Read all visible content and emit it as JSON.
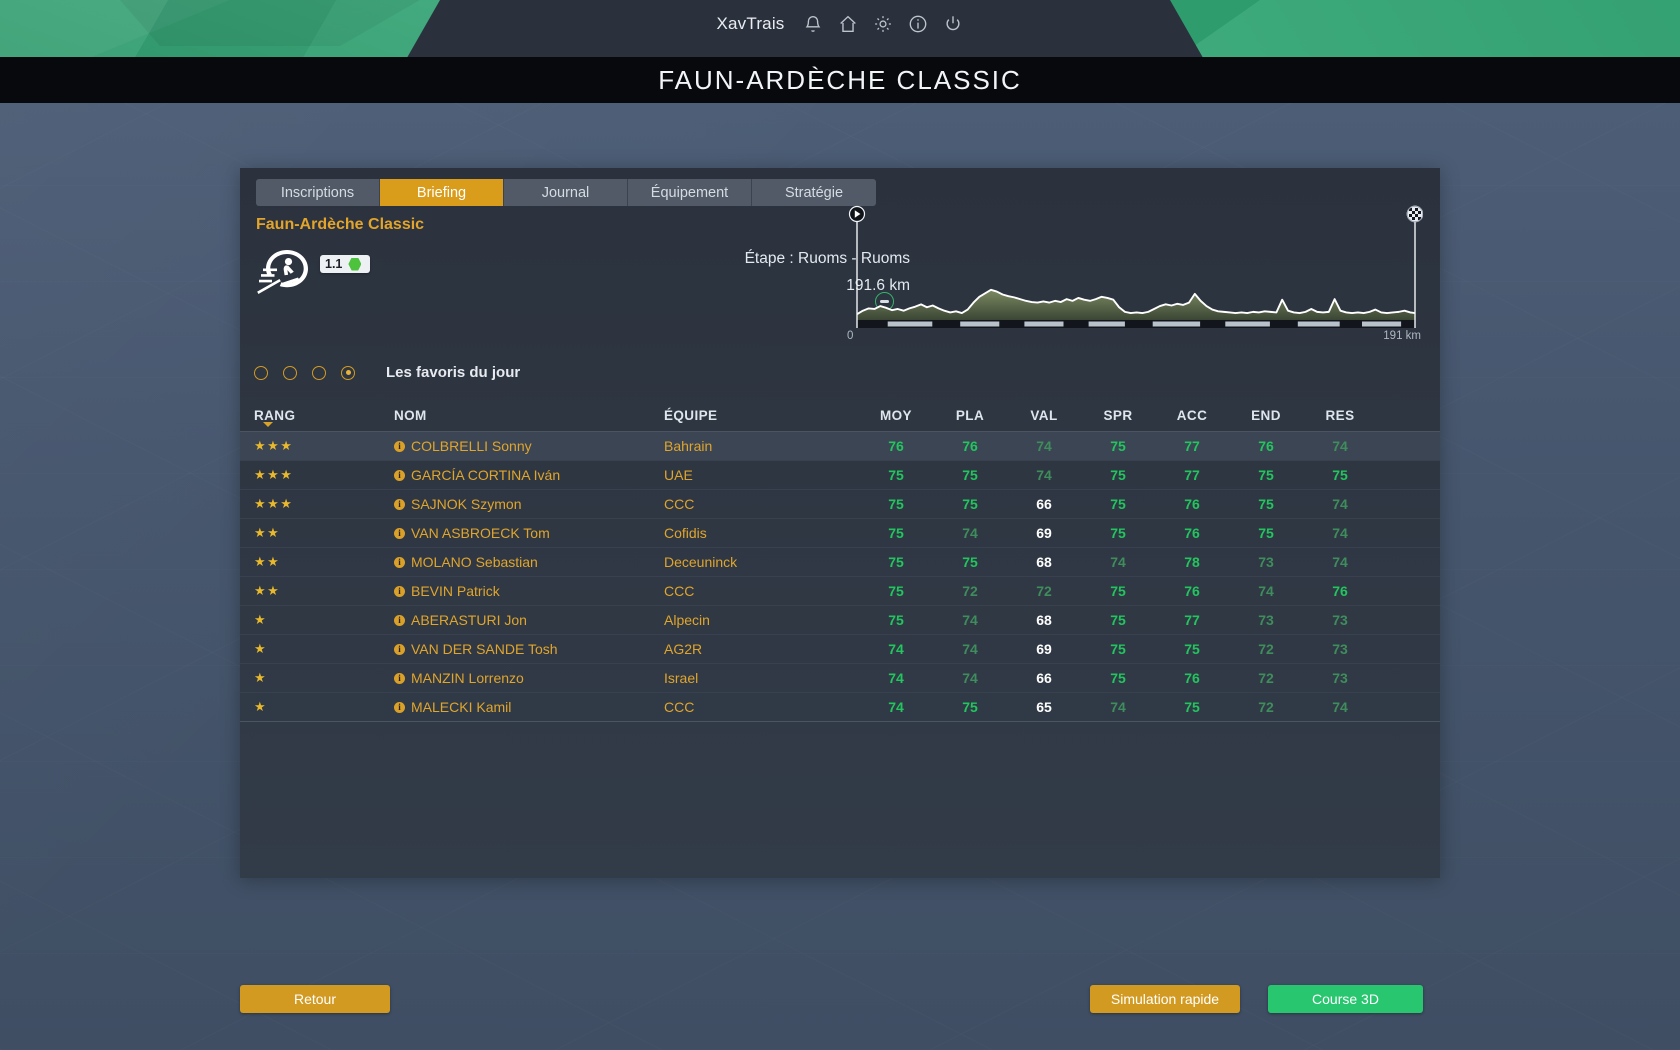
{
  "topbar": {
    "username": "XavTrais",
    "icons": [
      {
        "name": "bell-icon",
        "glyph": "bell"
      },
      {
        "name": "home-icon",
        "glyph": "home"
      },
      {
        "name": "gear-icon",
        "glyph": "gear"
      },
      {
        "name": "info-icon",
        "glyph": "info"
      },
      {
        "name": "power-icon",
        "glyph": "power"
      }
    ],
    "accent_green": "#2f9c6e",
    "center_dark": "#2b313c"
  },
  "title_band": {
    "title": "FAUN-ARDÈCHE CLASSIC"
  },
  "tabs": [
    {
      "label": "Inscriptions",
      "active": false
    },
    {
      "label": "Briefing",
      "active": true
    },
    {
      "label": "Journal",
      "active": false
    },
    {
      "label": "Équipement",
      "active": false
    },
    {
      "label": "Stratégie",
      "active": false
    }
  ],
  "race": {
    "name": "Faun-Ardèche Classic",
    "category_badge": "1.1",
    "badge_dot_color": "#4cc23d",
    "stage_label": "Étape : Ruoms - Ruoms",
    "distance": "191.6 km",
    "terrain_icon": "flat-stage-icon",
    "logo_icon": "cyclist-logo-icon"
  },
  "favorites_selector": {
    "options": 4,
    "selected_index": 3,
    "label": "Les favoris du jour"
  },
  "table": {
    "columns": [
      "RANG",
      "NOM",
      "ÉQUIPE",
      "MOY",
      "PLA",
      "VAL",
      "SPR",
      "ACC",
      "END",
      "RES"
    ],
    "sort_column": "RANG",
    "rows": [
      {
        "stars": 3,
        "name": "COLBRELLI Sonny",
        "team": "Bahrain",
        "moy": {
          "v": "76",
          "t": "hi"
        },
        "pla": {
          "v": "76",
          "t": "hi"
        },
        "val": {
          "v": "74",
          "t": "mid"
        },
        "spr": {
          "v": "75",
          "t": "hi"
        },
        "acc": {
          "v": "77",
          "t": "hi"
        },
        "end": {
          "v": "76",
          "t": "hi"
        },
        "res": {
          "v": "74",
          "t": "mid"
        },
        "selected": true
      },
      {
        "stars": 3,
        "name": "GARCÍA CORTINA Iván",
        "team": "UAE",
        "moy": {
          "v": "75",
          "t": "hi"
        },
        "pla": {
          "v": "75",
          "t": "hi"
        },
        "val": {
          "v": "74",
          "t": "mid"
        },
        "spr": {
          "v": "75",
          "t": "hi"
        },
        "acc": {
          "v": "77",
          "t": "hi"
        },
        "end": {
          "v": "75",
          "t": "hi"
        },
        "res": {
          "v": "75",
          "t": "hi"
        },
        "selected": false
      },
      {
        "stars": 3,
        "name": "SAJNOK Szymon",
        "team": "CCC",
        "moy": {
          "v": "75",
          "t": "hi"
        },
        "pla": {
          "v": "75",
          "t": "hi"
        },
        "val": {
          "v": "66",
          "t": "lo"
        },
        "spr": {
          "v": "75",
          "t": "hi"
        },
        "acc": {
          "v": "76",
          "t": "hi"
        },
        "end": {
          "v": "75",
          "t": "hi"
        },
        "res": {
          "v": "74",
          "t": "mid"
        },
        "selected": false
      },
      {
        "stars": 2,
        "name": "VAN ASBROECK Tom",
        "team": "Cofidis",
        "moy": {
          "v": "75",
          "t": "hi"
        },
        "pla": {
          "v": "74",
          "t": "mid"
        },
        "val": {
          "v": "69",
          "t": "lo"
        },
        "spr": {
          "v": "75",
          "t": "hi"
        },
        "acc": {
          "v": "76",
          "t": "hi"
        },
        "end": {
          "v": "75",
          "t": "hi"
        },
        "res": {
          "v": "74",
          "t": "mid"
        },
        "selected": false
      },
      {
        "stars": 2,
        "name": "MOLANO Sebastian",
        "team": "Deceuninck",
        "moy": {
          "v": "75",
          "t": "hi"
        },
        "pla": {
          "v": "75",
          "t": "hi"
        },
        "val": {
          "v": "68",
          "t": "lo"
        },
        "spr": {
          "v": "74",
          "t": "mid"
        },
        "acc": {
          "v": "78",
          "t": "hi"
        },
        "end": {
          "v": "73",
          "t": "mid"
        },
        "res": {
          "v": "74",
          "t": "mid"
        },
        "selected": false
      },
      {
        "stars": 2,
        "name": "BEVIN Patrick",
        "team": "CCC",
        "moy": {
          "v": "75",
          "t": "hi"
        },
        "pla": {
          "v": "72",
          "t": "mid"
        },
        "val": {
          "v": "72",
          "t": "mid"
        },
        "spr": {
          "v": "75",
          "t": "hi"
        },
        "acc": {
          "v": "76",
          "t": "hi"
        },
        "end": {
          "v": "74",
          "t": "mid"
        },
        "res": {
          "v": "76",
          "t": "hi"
        },
        "selected": false
      },
      {
        "stars": 1,
        "name": "ABERASTURI Jon",
        "team": "Alpecin",
        "moy": {
          "v": "75",
          "t": "hi"
        },
        "pla": {
          "v": "74",
          "t": "mid"
        },
        "val": {
          "v": "68",
          "t": "lo"
        },
        "spr": {
          "v": "75",
          "t": "hi"
        },
        "acc": {
          "v": "77",
          "t": "hi"
        },
        "end": {
          "v": "73",
          "t": "mid"
        },
        "res": {
          "v": "73",
          "t": "mid"
        },
        "selected": false
      },
      {
        "stars": 1,
        "name": "VAN DER SANDE Tosh",
        "team": "AG2R",
        "moy": {
          "v": "74",
          "t": "hi"
        },
        "pla": {
          "v": "74",
          "t": "mid"
        },
        "val": {
          "v": "69",
          "t": "lo"
        },
        "spr": {
          "v": "75",
          "t": "hi"
        },
        "acc": {
          "v": "75",
          "t": "hi"
        },
        "end": {
          "v": "72",
          "t": "mid"
        },
        "res": {
          "v": "73",
          "t": "mid"
        },
        "selected": false
      },
      {
        "stars": 1,
        "name": "MANZIN Lorrenzo",
        "team": "Israel",
        "moy": {
          "v": "74",
          "t": "hi"
        },
        "pla": {
          "v": "74",
          "t": "mid"
        },
        "val": {
          "v": "66",
          "t": "lo"
        },
        "spr": {
          "v": "75",
          "t": "hi"
        },
        "acc": {
          "v": "76",
          "t": "hi"
        },
        "end": {
          "v": "72",
          "t": "mid"
        },
        "res": {
          "v": "73",
          "t": "mid"
        },
        "selected": false
      },
      {
        "stars": 1,
        "name": "MALECKI Kamil",
        "team": "CCC",
        "moy": {
          "v": "74",
          "t": "hi"
        },
        "pla": {
          "v": "75",
          "t": "hi"
        },
        "val": {
          "v": "65",
          "t": "lo"
        },
        "spr": {
          "v": "74",
          "t": "mid"
        },
        "acc": {
          "v": "75",
          "t": "hi"
        },
        "end": {
          "v": "72",
          "t": "mid"
        },
        "res": {
          "v": "74",
          "t": "mid"
        },
        "selected": false
      }
    ]
  },
  "footer": {
    "back_label": "Retour",
    "quick_sim_label": "Simulation rapide",
    "race3d_label": "Course 3D",
    "orange": "#d29a21",
    "green": "#28c76f"
  },
  "chart_data": {
    "type": "area",
    "title": "",
    "xlabel": "",
    "ylabel": "",
    "x_tick_labels": [
      "0",
      "191 km"
    ],
    "xlim": [
      0,
      191.6
    ],
    "ylim": [
      0,
      1
    ],
    "grid": false,
    "legend_position": "none",
    "line_color": "#ffffff",
    "fill_color": "#6a7a55",
    "start_marker": "start-arrow-icon",
    "finish_marker": "checkered-flag-icon",
    "series": [
      {
        "name": "elevation",
        "x": [
          0,
          2,
          4,
          6,
          8,
          10,
          12,
          14,
          16,
          18,
          20,
          22,
          24,
          26,
          28,
          30,
          32,
          34,
          36,
          38,
          40,
          42,
          44,
          46,
          48,
          50,
          52,
          54,
          56,
          58,
          60,
          62,
          64,
          66,
          68,
          70,
          72,
          74,
          76,
          78,
          80,
          82,
          84,
          86,
          88,
          90,
          92,
          94,
          96,
          98,
          100,
          102,
          104,
          106,
          108,
          110,
          112,
          114,
          116,
          118,
          120,
          122,
          124,
          126,
          128,
          130,
          132,
          134,
          136,
          138,
          140,
          142,
          144,
          146,
          148,
          150,
          152,
          154,
          156,
          158,
          160,
          162,
          164,
          166,
          168,
          170,
          172,
          174,
          176,
          178,
          180,
          182,
          184,
          186,
          188,
          190,
          191.6
        ],
        "values": [
          0.1,
          0.16,
          0.2,
          0.19,
          0.24,
          0.21,
          0.17,
          0.19,
          0.16,
          0.2,
          0.23,
          0.27,
          0.22,
          0.25,
          0.2,
          0.16,
          0.13,
          0.15,
          0.12,
          0.18,
          0.3,
          0.4,
          0.46,
          0.52,
          0.49,
          0.44,
          0.41,
          0.39,
          0.36,
          0.33,
          0.31,
          0.3,
          0.32,
          0.3,
          0.33,
          0.31,
          0.36,
          0.33,
          0.38,
          0.35,
          0.33,
          0.36,
          0.4,
          0.38,
          0.35,
          0.22,
          0.14,
          0.12,
          0.13,
          0.12,
          0.14,
          0.19,
          0.24,
          0.27,
          0.25,
          0.28,
          0.26,
          0.3,
          0.45,
          0.33,
          0.24,
          0.18,
          0.15,
          0.14,
          0.13,
          0.12,
          0.13,
          0.12,
          0.14,
          0.13,
          0.15,
          0.14,
          0.13,
          0.35,
          0.16,
          0.13,
          0.12,
          0.14,
          0.19,
          0.14,
          0.13,
          0.14,
          0.36,
          0.16,
          0.13,
          0.12,
          0.13,
          0.12,
          0.14,
          0.18,
          0.13,
          0.12,
          0.13,
          0.14,
          0.16,
          0.13,
          0.12
        ]
      }
    ],
    "km_markers": [
      {
        "start": 0.055,
        "end": 0.135
      },
      {
        "start": 0.185,
        "end": 0.255
      },
      {
        "start": 0.3,
        "end": 0.37
      },
      {
        "start": 0.415,
        "end": 0.48
      },
      {
        "start": 0.53,
        "end": 0.615
      },
      {
        "start": 0.66,
        "end": 0.74
      },
      {
        "start": 0.79,
        "end": 0.865
      },
      {
        "start": 0.905,
        "end": 0.975
      }
    ]
  }
}
